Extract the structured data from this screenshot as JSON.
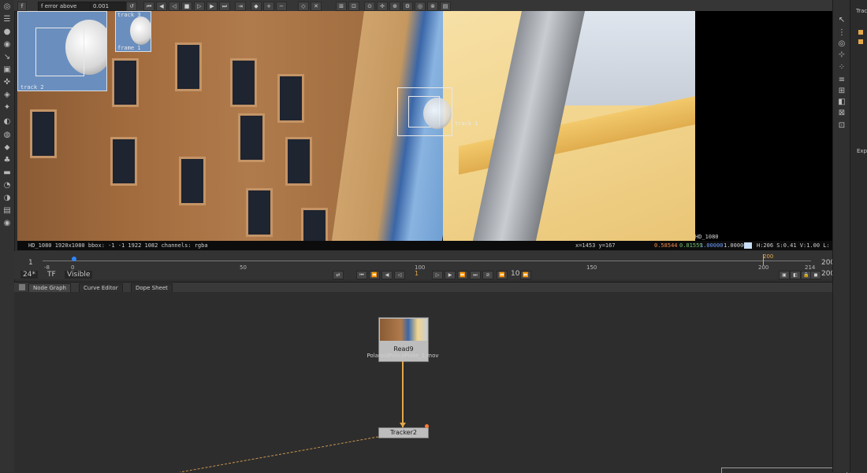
{
  "viewer_toolbar": {
    "error_mode": "f error above",
    "gain_value": "0.001"
  },
  "viewer": {
    "format_label": "HD_1080",
    "tracks": [
      {
        "name": "track 1"
      },
      {
        "name": "track 2"
      },
      {
        "name": "track 3"
      }
    ],
    "inset_labels": {
      "track2": "track 2",
      "track3": "track 3",
      "frame": "frame 1"
    }
  },
  "info_bar": {
    "format": "HD_1080 1920x1080  bbox: -1 -1 1922 1082 channels: rgba",
    "coords": "x=1453 y=167",
    "r": "0.58544",
    "g": "0.81559",
    "b": "1.00000",
    "a": "1.00000",
    "hsvl": "H:206 S:0.41 V:1.00  L: 0.78284",
    "swatch_color": "#c8dff7"
  },
  "timeline": {
    "start": "1",
    "end": "200",
    "ticks": [
      "-8",
      "0",
      "50",
      "100",
      "150",
      "200",
      "214"
    ],
    "current_marker": "200",
    "fps": "24*",
    "tf": "TF",
    "view": "Visible",
    "frame": "1",
    "increment": "10",
    "end_frame": "200"
  },
  "tabs": [
    {
      "label": "Node Graph"
    },
    {
      "label": "Curve Editor"
    },
    {
      "label": "Dope Sheet"
    }
  ],
  "nodes": {
    "read": {
      "title": "Read9",
      "file": "PolaroidPolicePlate_1.mov"
    },
    "tracker": {
      "title": "Tracker2"
    }
  },
  "right_panel": {
    "label_top": "Trac",
    "label_mid": "Exp"
  },
  "colors": {
    "accent": "#e3a84a",
    "playhead": "#2f86ff"
  }
}
